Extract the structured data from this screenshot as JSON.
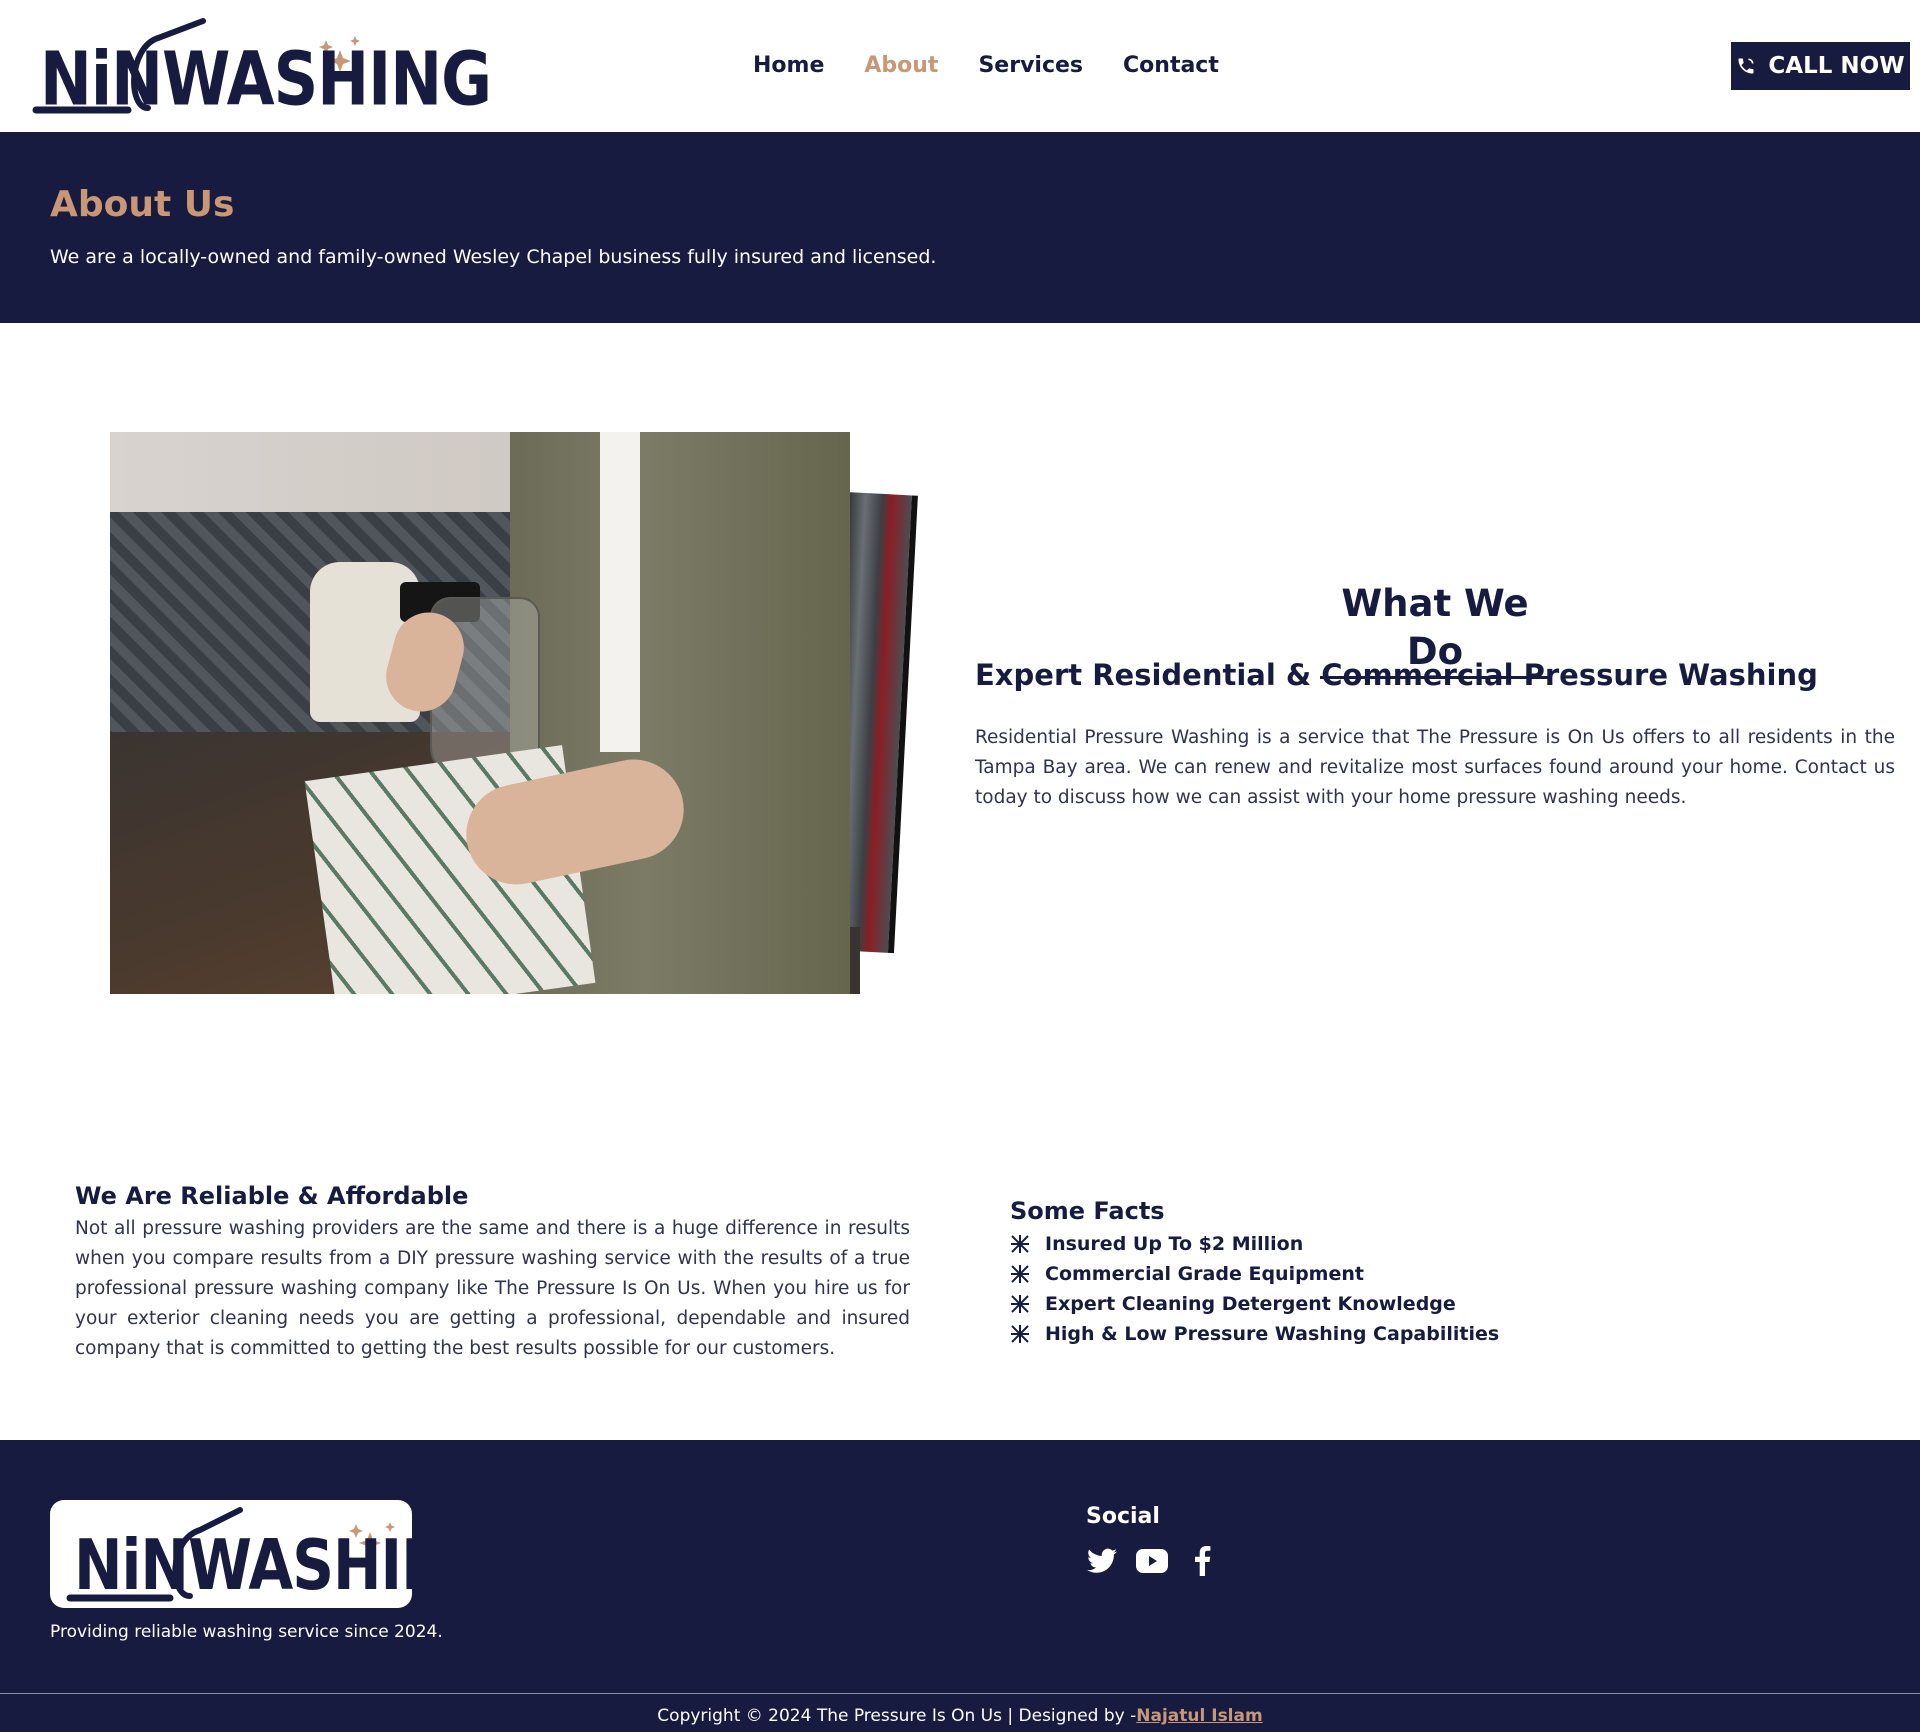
{
  "brand": {
    "logo_text": "NiNWASHING",
    "colors": {
      "navy": "#171b40",
      "accent": "#c99776",
      "white": "#ffffff"
    }
  },
  "nav": {
    "items": [
      {
        "label": "Home",
        "active": false
      },
      {
        "label": "About",
        "active": true
      },
      {
        "label": "Services",
        "active": false
      },
      {
        "label": "Contact",
        "active": false
      }
    ],
    "call_now": {
      "label": "CALL NOW",
      "icon": "phone-icon"
    }
  },
  "hero": {
    "title": "About Us",
    "subtitle": "We are a locally-owned and family-owned Wesley Chapel business fully insured and licensed."
  },
  "what_we_do": {
    "title": "What We Do",
    "subtitle": "Expert Residential & Commercial Pressure Washing",
    "text": "Residential Pressure Washing is a service that The Pressure is On Us offers to all residents in the Tampa Bay area. We can renew and revitalize most surfaces found around your home. Contact us today to discuss how we can assist with your home pressure washing needs."
  },
  "reliable": {
    "title": "We Are Reliable & Affordable",
    "text": "Not all pressure washing providers are the same and there is a huge difference in results when you compare results from a DIY pressure washing service with the results of a true professional pressure washing company like The Pressure Is On Us. When you hire us for your exterior cleaning needs you are getting a professional, dependable and insured company that is committed to getting the best results possible for our customers."
  },
  "facts": {
    "title": "Some Facts",
    "items": [
      "Insured Up To $2 Million",
      "Commercial Grade Equipment",
      "Expert Cleaning Detergent Knowledge",
      "High & Low Pressure Washing Capabilities"
    ]
  },
  "footer": {
    "tagline": "Providing reliable washing service since 2024.",
    "social_title": "Social",
    "social_icons": [
      "twitter-icon",
      "youtube-icon",
      "facebook-icon"
    ],
    "copyright": "Copyright © 2024 The Pressure Is On Us | Designed by -",
    "designer": "Najatul Islam"
  }
}
